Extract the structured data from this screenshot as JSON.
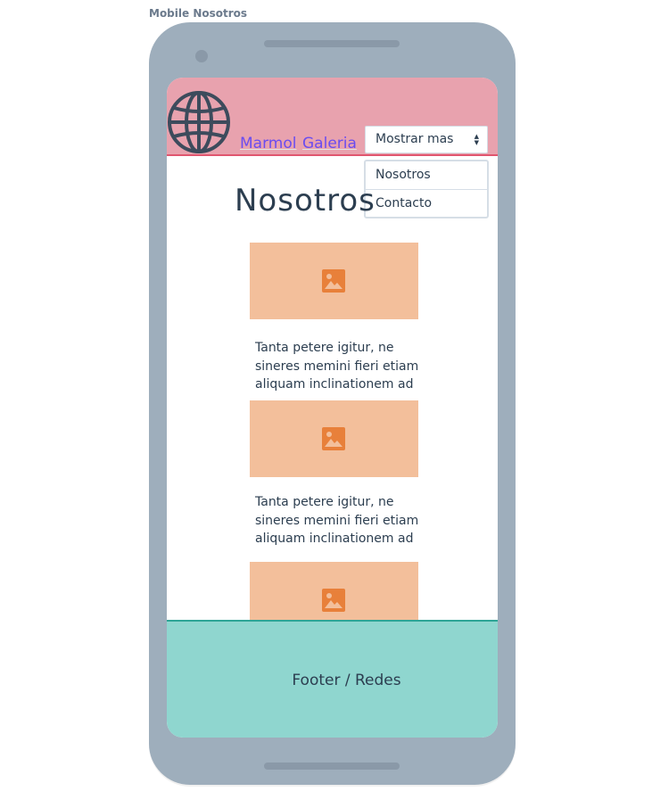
{
  "frame_label": "Mobile Nosotros",
  "header": {
    "logo_icon": "globe-icon",
    "nav": [
      {
        "label": "Marmol"
      },
      {
        "label": "Galeria"
      }
    ],
    "select": {
      "value": "Mostrar mas",
      "options": [
        "Nosotros",
        "Contacto"
      ]
    }
  },
  "main": {
    "title": "Nosotros",
    "image_icon": "image-icon",
    "blocks": [
      {
        "text": "Tanta petere igitur, ne sineres memini fieri etiam aliquam inclinationem ad"
      },
      {
        "text": "Tanta petere igitur, ne sineres memini fieri etiam aliquam inclinationem ad"
      }
    ]
  },
  "footer": {
    "text": "Footer / Redes"
  },
  "colors": {
    "header_bg": "#e8a2ae",
    "header_border": "#e0566f",
    "nav_link": "#6a4cf0",
    "image_placeholder": "#f3bf9b",
    "image_icon": "#e8803a",
    "footer_bg": "#8fd6cf",
    "phone_body": "#9eaebc"
  }
}
